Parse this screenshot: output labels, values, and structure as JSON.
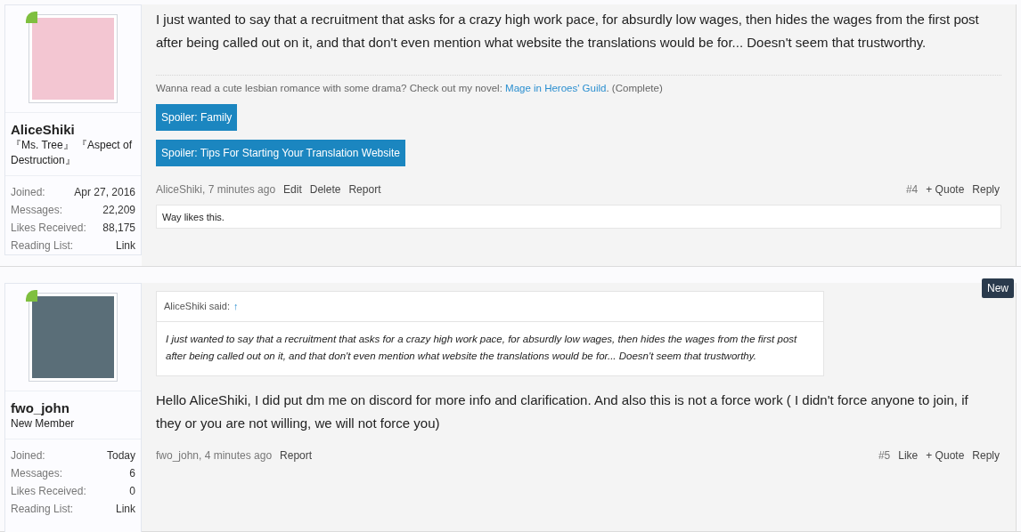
{
  "posts": [
    {
      "author": {
        "name": "AliceShiki",
        "title": "『Ms. Tree』 『Aspect of Destruction』",
        "online": true,
        "stats": [
          {
            "label": "Joined:",
            "value": "Apr 27, 2016"
          },
          {
            "label": "Messages:",
            "value": "22,209"
          },
          {
            "label": "Likes Received:",
            "value": "88,175"
          },
          {
            "label": "Reading List:",
            "value": "Link"
          }
        ]
      },
      "body": "I just wanted to say that a recruitment that asks for a crazy high work pace, for absurdly low wages, then hides the wages from the first post after being called out on it, and that don't even mention what website the translations would be for... Doesn't seem that trustworthy.",
      "signature": {
        "before": "Wanna read a cute lesbian romance with some drama? Check out my novel: ",
        "link": "Mage in Heroes' Guild",
        "after": ". (Complete)"
      },
      "spoilers": [
        "Spoiler: Family",
        "Spoiler: Tips For Starting Your Translation Website"
      ],
      "byline": "AliceShiki, 7 minutes ago",
      "left_actions": [
        "Edit",
        "Delete",
        "Report"
      ],
      "number": "#4",
      "right_actions": [
        "+ Quote",
        "Reply"
      ],
      "likes": "Way likes this."
    },
    {
      "author": {
        "name": "fwo_john",
        "title": "New Member",
        "online": true,
        "stats": [
          {
            "label": "Joined:",
            "value": "Today"
          },
          {
            "label": "Messages:",
            "value": "6"
          },
          {
            "label": "Likes Received:",
            "value": "0"
          },
          {
            "label": "Reading List:",
            "value": "Link"
          }
        ]
      },
      "badge": "New",
      "quote": {
        "attribution": "AliceShiki said:",
        "arrow": "↑",
        "body": "I just wanted to say that a recruitment that asks for a crazy high work pace, for absurdly low wages, then hides the wages from the first post after being called out on it, and that don't even mention what website the translations would be for... Doesn't seem that trustworthy."
      },
      "body": "Hello AliceShiki, I did put dm me on discord for more info and clarification. And also this is not a force work ( I didn't force anyone to join, if they or you are not willing, we will not force you)",
      "byline": "fwo_john, 4 minutes ago",
      "left_actions": [
        "Report"
      ],
      "number": "#5",
      "right_actions": [
        "Like",
        "+ Quote",
        "Reply"
      ]
    }
  ]
}
